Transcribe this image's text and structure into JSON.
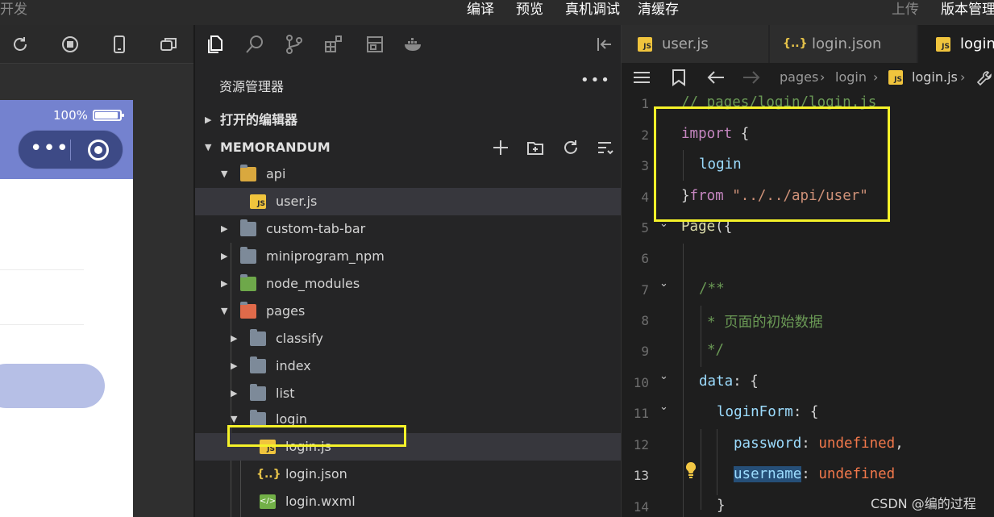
{
  "menubar": {
    "left_label": "开发",
    "compile": "编译",
    "preview": "预览",
    "real_debug": "真机调试",
    "clear_cache": "清缓存",
    "upload": "上传",
    "version": "版本管理"
  },
  "simulator": {
    "battery_percent": "100%"
  },
  "explorer": {
    "title": "资源管理器",
    "more": "•••",
    "open_editors": "打开的编辑器",
    "project": "MEMORANDUM",
    "tree": [
      {
        "name": "api",
        "type": "folder-open",
        "depth": 1
      },
      {
        "name": "user.js",
        "type": "js",
        "depth": 2
      },
      {
        "name": "custom-tab-bar",
        "type": "folder",
        "depth": 1
      },
      {
        "name": "miniprogram_npm",
        "type": "folder",
        "depth": 1
      },
      {
        "name": "node_modules",
        "type": "folder",
        "depth": 1
      },
      {
        "name": "pages",
        "type": "folder-open",
        "depth": 1
      },
      {
        "name": "classify",
        "type": "folder",
        "depth": 2
      },
      {
        "name": "index",
        "type": "folder",
        "depth": 2
      },
      {
        "name": "list",
        "type": "folder",
        "depth": 2
      },
      {
        "name": "login",
        "type": "folder-open",
        "depth": 2
      },
      {
        "name": "login.js",
        "type": "js",
        "depth": 3
      },
      {
        "name": "login.json",
        "type": "json",
        "depth": 3
      },
      {
        "name": "login.wxml",
        "type": "wxml",
        "depth": 3
      }
    ]
  },
  "editor": {
    "tabs": [
      {
        "label": "user.js",
        "icon": "js"
      },
      {
        "label": "login.json",
        "icon": "json"
      },
      {
        "label": "login.js",
        "icon": "js"
      }
    ],
    "breadcrumb": [
      "pages",
      "login",
      "login.js"
    ],
    "line_numbers": [
      "1",
      "2",
      "3",
      "4",
      "5",
      "6",
      "7",
      "8",
      "9",
      "10",
      "11",
      "12",
      "13",
      "14"
    ],
    "current_line": "13",
    "code": {
      "l1": "// pages/login/login.js",
      "l2_kw": "import",
      "l2_rest": " {",
      "l3": "login",
      "l4_brace": "}",
      "l4_kw": "from",
      "l4_str": "\"../../api/user\"",
      "l5_fn": "Page",
      "l5_rest": "({",
      "l7": "/**",
      "l8": "* 页面的初始数据",
      "l9": "*/",
      "l10_key": "data",
      "l10_rest": ": {",
      "l11_key": "loginForm",
      "l11_rest": ": {",
      "l12_key": "password",
      "l12_sep": ": ",
      "l12_val": "undefined",
      "l12_end": ",",
      "l13_key": "username",
      "l13_sep": ": ",
      "l13_val": "undefined",
      "l14": "}"
    }
  },
  "watermark": "CSDN @编的过程",
  "colors": {
    "highlight_box": "#f5f229",
    "phone_nav": "#7482cf",
    "js_badge": "#f0c43d"
  }
}
